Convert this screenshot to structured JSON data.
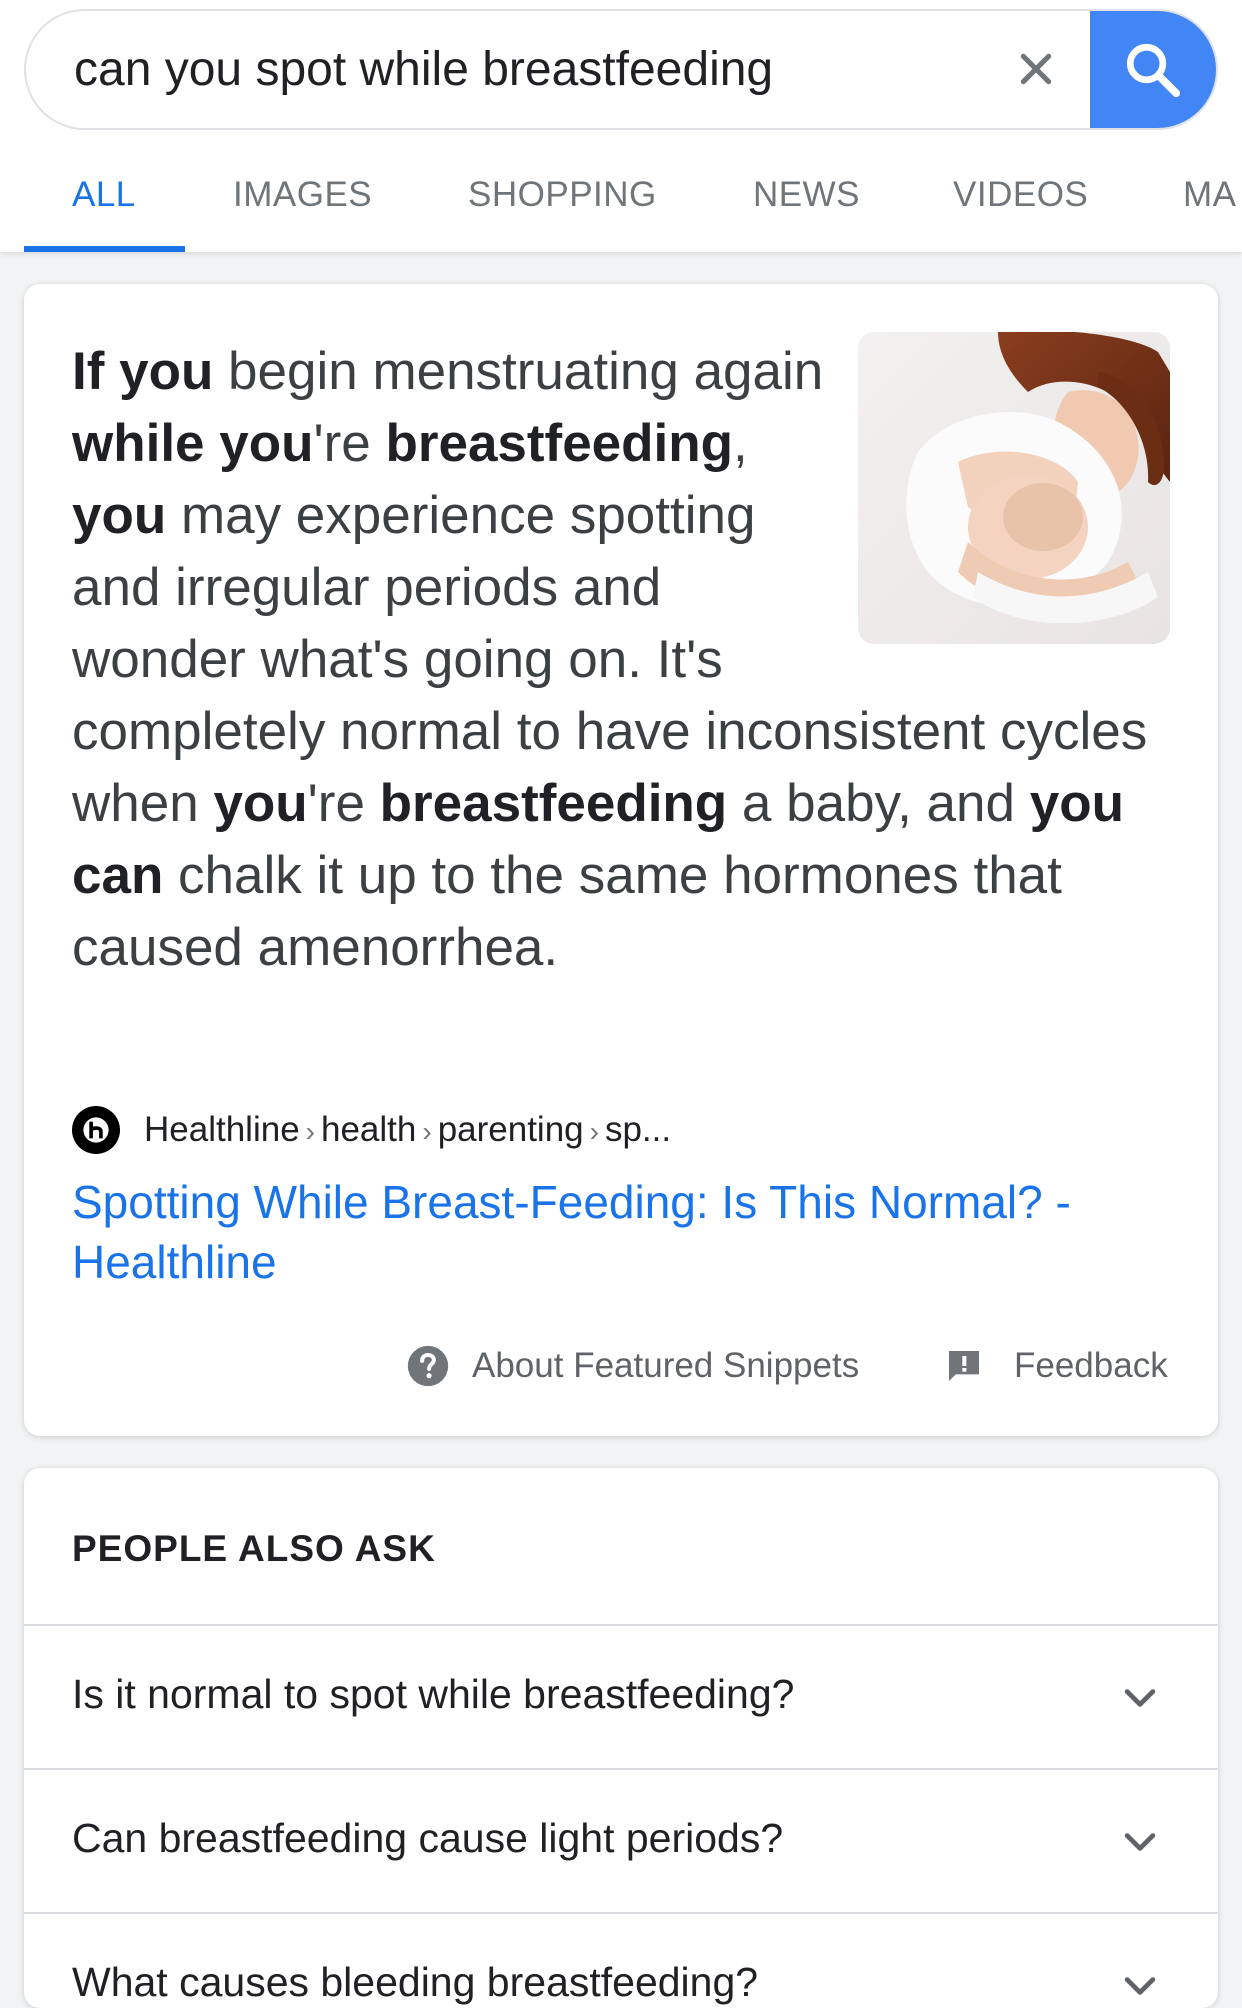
{
  "search": {
    "query": "can you spot while breastfeeding",
    "clear_icon": "close-icon",
    "search_icon": "search-icon",
    "accent_color": "#4285f4"
  },
  "tabs": [
    {
      "label": "ALL",
      "active": true
    },
    {
      "label": "IMAGES",
      "active": false
    },
    {
      "label": "SHOPPING",
      "active": false
    },
    {
      "label": "NEWS",
      "active": false
    },
    {
      "label": "VIDEOS",
      "active": false
    },
    {
      "label": "MA",
      "active": false
    }
  ],
  "featured_snippet": {
    "segments": [
      {
        "text": "If you",
        "bold": true
      },
      {
        "text": " begin menstruating again ",
        "bold": false
      },
      {
        "text": "while you",
        "bold": true
      },
      {
        "text": "'re ",
        "bold": false
      },
      {
        "text": "breastfeeding",
        "bold": true
      },
      {
        "text": ", ",
        "bold": false
      },
      {
        "text": "you",
        "bold": true
      },
      {
        "text": " may experience spotting and irregular periods and wonder what's going on. It's completely normal to have inconsistent cycles when ",
        "bold": false
      },
      {
        "text": "you",
        "bold": true
      },
      {
        "text": "'re ",
        "bold": false
      },
      {
        "text": "breastfeeding",
        "bold": true
      },
      {
        "text": " a baby, and ",
        "bold": false
      },
      {
        "text": "you can",
        "bold": true
      },
      {
        "text": " chalk it up to the same hormones that caused amenorrhea.",
        "bold": false
      }
    ],
    "image_icon": "mother-breastfeeding-photo",
    "source": {
      "favicon": "healthline-logo-icon",
      "site": "Healthline",
      "path": [
        "health",
        "parenting",
        "sp..."
      ]
    },
    "link_title": "Spotting While Breast-Feeding: Is This Normal? - Healthline",
    "footer": {
      "about_label": "About Featured Snippets",
      "about_icon": "help-circle-icon",
      "feedback_label": "Feedback",
      "feedback_icon": "feedback-icon"
    }
  },
  "people_also_ask": {
    "title": "PEOPLE ALSO ASK",
    "questions": [
      "Is it normal to spot while breastfeeding?",
      "Can breastfeeding cause light periods?",
      "What causes bleeding breastfeeding?"
    ]
  }
}
